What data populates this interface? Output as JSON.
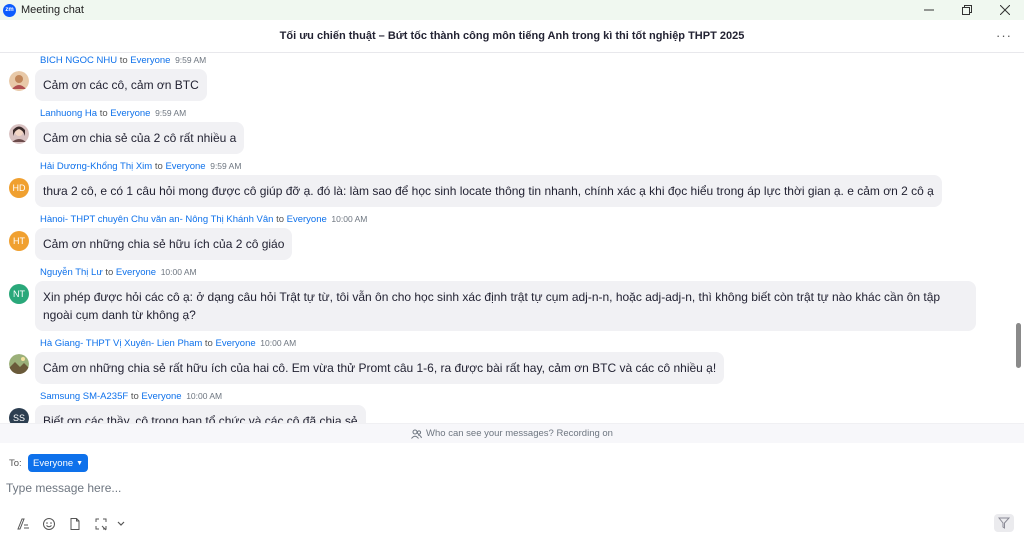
{
  "window": {
    "app_logo": "zm",
    "title": "Meeting chat"
  },
  "header": {
    "title": "Tối ưu chiến thuật – Bứt tốc thành công môn tiếng Anh trong kì thi tốt nghiệp THPT 2025",
    "more": "···"
  },
  "messages": [
    {
      "sender": "BICH NGOC NHU",
      "to": "to",
      "recipient": "Everyone",
      "time": "9:59 AM",
      "avatar": "",
      "avatar_color": "#c0865a",
      "text": "Cảm ơn các cô, cảm ơn BTC"
    },
    {
      "sender": "Lanhuong Ha",
      "to": "to",
      "recipient": "Everyone",
      "time": "9:59 AM",
      "avatar": "",
      "avatar_color": "#6b4a4a",
      "text": "Cảm ơn chia sẻ của 2 cô rất nhiều a"
    },
    {
      "sender": "Hải Dương-Khổng Thị Xim",
      "to": "to",
      "recipient": "Everyone",
      "time": "9:59 AM",
      "avatar": "HD",
      "avatar_color": "#f0a030",
      "text": "thưa 2 cô, e có 1 câu hỏi mong được cô giúp đỡ ạ. đó là: làm sao để học sinh locate thông tin nhanh, chính xác ạ khi đọc hiểu trong áp lực thời gian ạ. e cảm ơn 2 cô ạ"
    },
    {
      "sender": "Hànoi- THPT chuyên Chu văn an- Nông Thị Khánh Vân",
      "to": "to",
      "recipient": "Everyone",
      "time": "10:00 AM",
      "avatar": "HT",
      "avatar_color": "#f0a030",
      "text": "Cảm ơn những chia sẻ hữu ích của 2 cô giáo"
    },
    {
      "sender": "Nguyễn Thị Lư",
      "to": "to",
      "recipient": "Everyone",
      "time": "10:00 AM",
      "avatar": "NT",
      "avatar_color": "#2aa87a",
      "text": "Xin phép được hỏi các cô ạ: ở dạng câu hỏi Trật tự từ, tôi vẫn ôn cho học sinh xác định trật tự cụm adj-n-n, hoặc adj-adj-n, thì không biết còn trật tự nào khác cần ôn tập ngoài cụm danh từ không ạ?"
    },
    {
      "sender": "Hà Giang- THPT Vị Xuyên- Lien Pham",
      "to": "to",
      "recipient": "Everyone",
      "time": "10:00 AM",
      "avatar": "",
      "avatar_color": "#8a7a55",
      "text": "Cảm ơn những chia sẻ rất hữu ích của hai cô. Em vừa thử Promt câu 1-6, ra được bài rất hay, cảm ơn BTC và các cô nhiều ạ!"
    },
    {
      "sender": "Samsung SM-A235F",
      "to": "to",
      "recipient": "Everyone",
      "time": "10:00 AM",
      "avatar": "SS",
      "avatar_color": "#2c3e50",
      "text": "Biết ơn các thầy, cô trong ban tổ chức và các cô đã chia sẻ"
    }
  ],
  "notice": {
    "text": "Who can see your messages? Recording on"
  },
  "composer": {
    "to_label": "To:",
    "recipient": "Everyone",
    "placeholder": "Type message here..."
  },
  "toolbar": {
    "icons": [
      "format-icon",
      "emoji-icon",
      "file-icon",
      "screenshot-icon",
      "chevron-down-icon"
    ]
  },
  "colors": {
    "accent": "#0e71eb",
    "bubble": "#f1f1f4",
    "titlebar": "#f0f8f0"
  }
}
